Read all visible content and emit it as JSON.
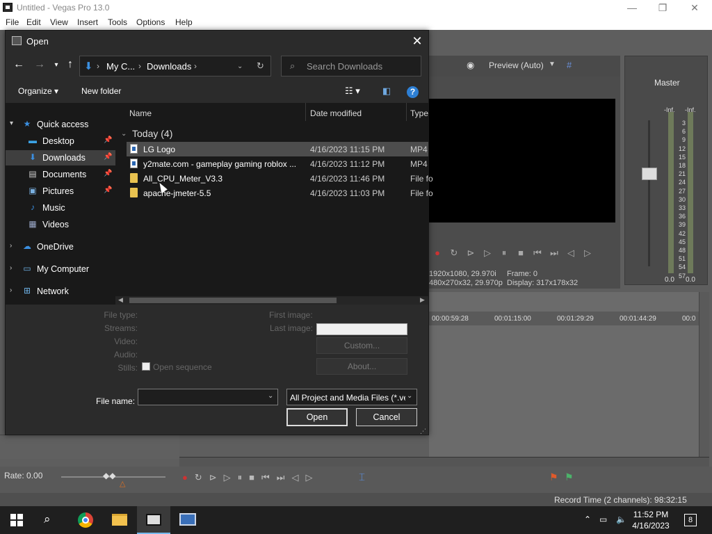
{
  "window": {
    "title": "Untitled - Vegas Pro 13.0",
    "minimize": "—",
    "maximize": "❐",
    "close": "✕"
  },
  "menu": [
    "File",
    "Edit",
    "View",
    "Insert",
    "Tools",
    "Options",
    "Help"
  ],
  "preview": {
    "mode_label": "Preview (Auto)",
    "project_info": "1920x1080, 29.970i",
    "preview_info": "480x270x32, 29.970p",
    "frame_label": "Frame:",
    "frame_value": "0",
    "display_label": "Display:",
    "display_value": "317x178x32"
  },
  "master": {
    "label": "Master",
    "inf_left": "-Inf.",
    "inf_right": "-Inf.",
    "scale": [
      "3",
      "6",
      "9",
      "12",
      "15",
      "18",
      "21",
      "24",
      "27",
      "30",
      "33",
      "36",
      "39",
      "42",
      "45",
      "48",
      "51",
      "54",
      "57"
    ],
    "zero_left": "0.0",
    "zero_right": "0.0"
  },
  "timeline": {
    "ruler": [
      "00:00:59:28",
      "00:01:15:00",
      "00:01:29:29",
      "00:01:44:29",
      "00:0"
    ],
    "rate": "Rate: 0.00",
    "record_time": "Record Time (2 channels): 98:32:15"
  },
  "dialog": {
    "title": "Open",
    "close": "✕",
    "breadcrumb": [
      "My C...",
      "Downloads"
    ],
    "search_placeholder": "Search Downloads",
    "organize": "Organize ▾",
    "new_folder": "New folder",
    "nav": [
      {
        "label": "Quick access",
        "icon": "star-icon",
        "expand": "▾",
        "pinned": false,
        "selected": false
      },
      {
        "label": "Desktop",
        "icon": "desktop-icon",
        "expand": "",
        "pinned": true,
        "selected": false
      },
      {
        "label": "Downloads",
        "icon": "download-icon",
        "expand": "",
        "pinned": true,
        "selected": true
      },
      {
        "label": "Documents",
        "icon": "documents-icon",
        "expand": "",
        "pinned": true,
        "selected": false
      },
      {
        "label": "Pictures",
        "icon": "pictures-icon",
        "expand": "",
        "pinned": true,
        "selected": false
      },
      {
        "label": "Music",
        "icon": "music-icon",
        "expand": "",
        "pinned": false,
        "selected": false
      },
      {
        "label": "Videos",
        "icon": "videos-icon",
        "expand": "",
        "pinned": false,
        "selected": false
      },
      {
        "label": "OneDrive",
        "icon": "cloud-icon",
        "expand": "›",
        "pinned": false,
        "selected": false
      },
      {
        "label": "My Computer",
        "icon": "computer-icon",
        "expand": "›",
        "pinned": false,
        "selected": false
      },
      {
        "label": "Network",
        "icon": "network-icon",
        "expand": "›",
        "pinned": false,
        "selected": false
      }
    ],
    "columns": [
      "Name",
      "Date modified",
      "Type"
    ],
    "group": "Today (4)",
    "files": [
      {
        "name": "LG Logo",
        "date": "4/16/2023 11:15 PM",
        "type": "MP4",
        "kind": "video"
      },
      {
        "name": "y2mate.com - gameplay gaming roblox ...",
        "date": "4/16/2023 11:12 PM",
        "type": "MP4",
        "kind": "video"
      },
      {
        "name": "All_CPU_Meter_V3.3",
        "date": "4/16/2023 11:46 PM",
        "type": "File fo",
        "kind": "folder"
      },
      {
        "name": "apache-jmeter-5.5",
        "date": "4/16/2023 11:03 PM",
        "type": "File fo",
        "kind": "folder"
      }
    ],
    "props": {
      "file_type": "File type:",
      "streams": "Streams:",
      "video": "Video:",
      "audio": "Audio:",
      "stills": "Stills:",
      "open_sequence": "Open sequence",
      "first_image": "First image:",
      "last_image": "Last image:",
      "custom": "Custom...",
      "about": "About..."
    },
    "file_name_label": "File name:",
    "file_name_value": "",
    "file_type_value": "All Project and Media Files (*.ve",
    "open_button": "Open",
    "cancel_button": "Cancel"
  },
  "taskbar": {
    "time": "11:52 PM",
    "date": "4/16/2023",
    "notifications": "8"
  }
}
